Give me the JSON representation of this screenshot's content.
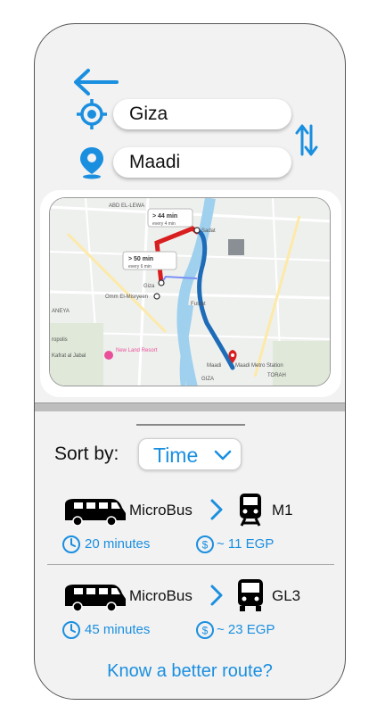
{
  "origin": {
    "value": "Giza"
  },
  "destination": {
    "value": "Maadi"
  },
  "map": {
    "place_labels": [
      "Sadat",
      "Giza",
      "Omm El-Misryeen",
      "Fustat",
      "Maadi",
      "Maadi Metro Station",
      "Kafrat al Jabal",
      "New Land Resort",
      "ropolis",
      "ANEYA",
      "TORAH",
      "GIZA",
      "ABD EL-LEWA"
    ],
    "segments": [
      {
        "label": "> 44 min",
        "sub": "every 4 min"
      },
      {
        "label": "> 50 min",
        "sub": "every 6 min"
      }
    ],
    "colors": {
      "rail_blue": "#1e6bb8",
      "rail_red": "#d81e1e",
      "river": "#9fd0ee"
    }
  },
  "sort": {
    "label": "Sort by:",
    "selected": "Time"
  },
  "routes": [
    {
      "mode1": "MicroBus",
      "mode2": "M1",
      "mode2_icon": "train-icon",
      "time": "20 minutes",
      "fare": "~ 11 EGP"
    },
    {
      "mode1": "MicroBus",
      "mode2": "GL3",
      "mode2_icon": "bus-icon",
      "time": "45 minutes",
      "fare": "~ 23 EGP"
    }
  ],
  "footer": {
    "link": "Know a better route?"
  },
  "colors": {
    "accent": "#1a8fe0",
    "panel": "#f2f2f2"
  }
}
